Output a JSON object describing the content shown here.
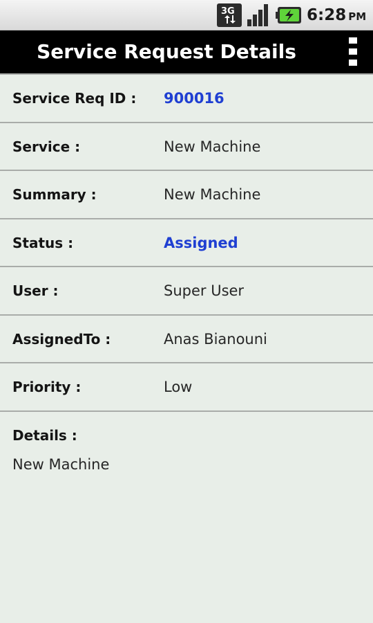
{
  "status_bar": {
    "network_label": "3G",
    "time": "6:28",
    "ampm": "PM",
    "icons": [
      "3g-data-icon",
      "signal-icon",
      "battery-charging-icon"
    ]
  },
  "header": {
    "title": "Service Request Details",
    "menu_icon": "overflow-menu-icon"
  },
  "fields": [
    {
      "label": "Service Req ID :",
      "value": "900016"
    },
    {
      "label": "Service :",
      "value": "New Machine"
    },
    {
      "label": "Summary :",
      "value": "New Machine"
    },
    {
      "label": "Status :",
      "value": "Assigned"
    },
    {
      "label": "User :",
      "value": "Super User"
    },
    {
      "label": "AssignedTo :",
      "value": "Anas Bianouni"
    },
    {
      "label": "Priority :",
      "value": "Low"
    }
  ],
  "details": {
    "label": "Details :",
    "value": "New Machine"
  },
  "colors": {
    "background": "#e8eee8",
    "title_bar": "#000000",
    "accent_text": "#1f3fd2",
    "battery_green": "#5fd43a",
    "divider": "#a9aca9"
  }
}
